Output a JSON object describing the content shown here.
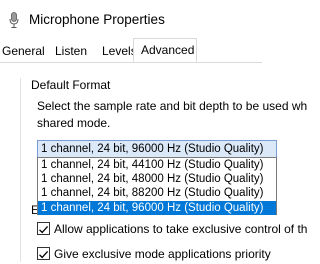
{
  "window": {
    "title": "Microphone Properties",
    "icon": "microphone-icon"
  },
  "tabs": [
    {
      "label": "General",
      "active": false
    },
    {
      "label": "Listen",
      "active": false
    },
    {
      "label": "Levels",
      "active": false
    },
    {
      "label": "Advanced",
      "active": true
    }
  ],
  "default_format": {
    "group_label": "Default Format",
    "description_line1": "Select the sample rate and bit depth to be used wh",
    "description_line2": "shared mode.",
    "selected_value": "1 channel, 24 bit, 96000 Hz (Studio Quality)",
    "options": [
      "1 channel, 24 bit, 44100 Hz (Studio Quality)",
      "1 channel, 24 bit, 48000 Hz (Studio Quality)",
      "1 channel, 24 bit, 88200 Hz (Studio Quality)",
      "1 channel, 24 bit, 96000 Hz (Studio Quality)"
    ],
    "highlighted_option_index": 3
  },
  "exclusive_mode": {
    "group_label_peek": "Ex",
    "allow_exclusive_label": "Allow applications to take exclusive control of th",
    "allow_exclusive_checked": true,
    "priority_label": "Give exclusive mode applications priority",
    "priority_checked": true
  },
  "colors": {
    "accent": "#0078d7",
    "selected_field_bg": "#dbe8f7"
  }
}
